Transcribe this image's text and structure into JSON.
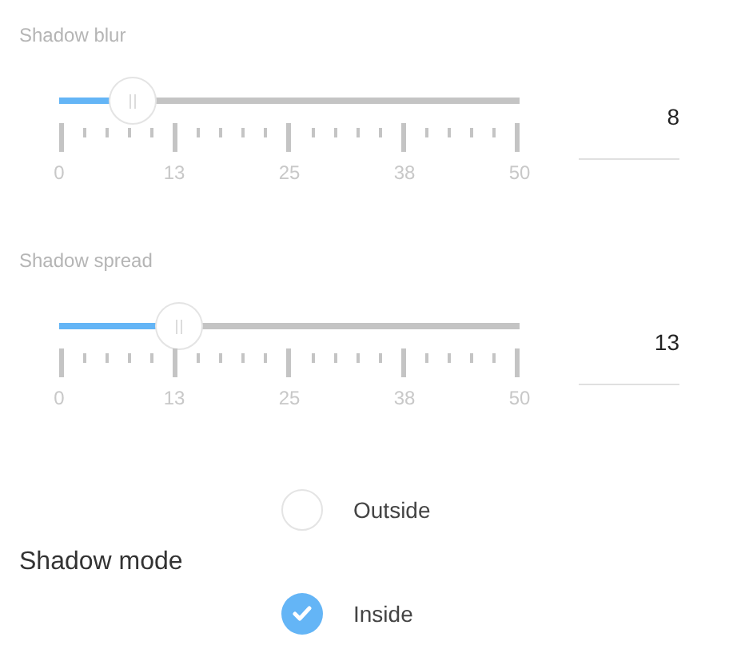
{
  "sliders": [
    {
      "label": "Shadow blur",
      "level": 0.16,
      "value": "8",
      "ticks": [
        "0",
        "13",
        "25",
        "38",
        "50"
      ]
    },
    {
      "label": "Shadow spread",
      "level": 0.26,
      "value": "13",
      "ticks": [
        "0",
        "13",
        "25",
        "38",
        "50"
      ]
    }
  ],
  "shadow_mode": {
    "label": "Shadow mode",
    "options": [
      {
        "label": "Outside",
        "selected": false
      },
      {
        "label": "Inside",
        "selected": true
      }
    ]
  }
}
